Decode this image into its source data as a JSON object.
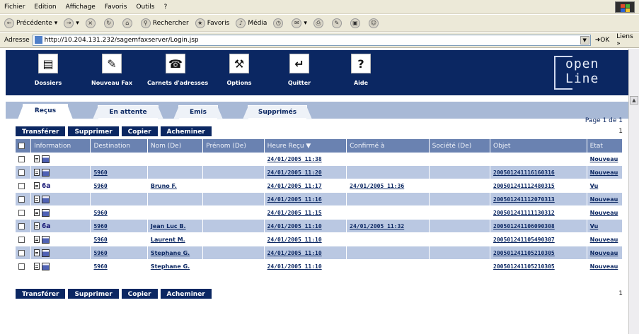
{
  "menubar": {
    "items": [
      "Fichier",
      "Edition",
      "Affichage",
      "Favoris",
      "Outils",
      "?"
    ]
  },
  "toolbar": {
    "back_label": "Précédente",
    "search_label": "Rechercher",
    "favorites_label": "Favoris",
    "media_label": "Média"
  },
  "addressbar": {
    "label": "Adresse",
    "url": "http://10.204.131.232/sagemfaxserver/Login.jsp",
    "go_label": "OK",
    "links_label": "Liens »"
  },
  "banner": {
    "items": [
      {
        "label": "Dossiers",
        "icon": "folders-icon",
        "glyph": "▤"
      },
      {
        "label": "Nouveau Fax",
        "icon": "new-fax-icon",
        "glyph": "✎"
      },
      {
        "label": "Carnets d'adresses",
        "icon": "phone-icon",
        "glyph": "☎"
      },
      {
        "label": "Options",
        "icon": "wrench-icon",
        "glyph": "⚒"
      },
      {
        "label": "Quitter",
        "icon": "exit-icon",
        "glyph": "↵"
      },
      {
        "label": "Aide",
        "icon": "help-icon",
        "glyph": "?"
      }
    ],
    "logo_line1": "open",
    "logo_line2": "Line"
  },
  "tabs": [
    "Reçus",
    "En attente",
    "Emis",
    "Supprimés"
  ],
  "active_tab": "Reçus",
  "pagination": {
    "label": "Page 1 de 1",
    "number": "1"
  },
  "actions": [
    "Transférer",
    "Supprimer",
    "Copier",
    "Acheminer"
  ],
  "columns": [
    "Information",
    "Destination",
    "Nom (De)",
    "Prénom (De)",
    "Heure Reçu ▼",
    "Confirmé à",
    "Société (De)",
    "Objet",
    "Etat"
  ],
  "rows": [
    {
      "info": "fax",
      "destination": "",
      "nom": "",
      "prenom": "",
      "heure": "24/01/2005 11:38",
      "confirme": "",
      "societe": "",
      "objet": "",
      "etat": "Nouveau"
    },
    {
      "info": "fax",
      "destination": "5960",
      "nom": "",
      "prenom": "",
      "heure": "24/01/2005 11:20",
      "confirme": "",
      "societe": "",
      "objet": "200501241116160316",
      "etat": "Nouveau"
    },
    {
      "info": "read",
      "destination": "5960",
      "nom": "Bruno F.",
      "prenom": "",
      "heure": "24/01/2005 11:17",
      "confirme": "24/01/2005 11:36",
      "societe": "",
      "objet": "200501241112480315",
      "etat": "Vu"
    },
    {
      "info": "fax",
      "destination": "",
      "nom": "",
      "prenom": "",
      "heure": "24/01/2005 11:16",
      "confirme": "",
      "societe": "",
      "objet": "200501241112070313",
      "etat": "Nouveau"
    },
    {
      "info": "fax",
      "destination": "5960",
      "nom": "",
      "prenom": "",
      "heure": "24/01/2005 11:15",
      "confirme": "",
      "societe": "",
      "objet": "200501241111130312",
      "etat": "Nouveau"
    },
    {
      "info": "read",
      "destination": "5960",
      "nom": "Jean Luc B.",
      "prenom": "",
      "heure": "24/01/2005 11:10",
      "confirme": "24/01/2005 11:32",
      "societe": "",
      "objet": "200501241106090308",
      "etat": "Vu"
    },
    {
      "info": "fax",
      "destination": "5960",
      "nom": "Laurent M.",
      "prenom": "",
      "heure": "24/01/2005 11:10",
      "confirme": "",
      "societe": "",
      "objet": "200501241105490307",
      "etat": "Nouveau"
    },
    {
      "info": "fax",
      "destination": "5960",
      "nom": "Stephane G.",
      "prenom": "",
      "heure": "24/01/2005 11:10",
      "confirme": "",
      "societe": "",
      "objet": "200501241105210305",
      "etat": "Nouveau"
    },
    {
      "info": "fax",
      "destination": "5960",
      "nom": "Stephane G.",
      "prenom": "",
      "heure": "24/01/2005 11:10",
      "confirme": "",
      "societe": "",
      "objet": "200501241105210305",
      "etat": "Nouveau"
    }
  ],
  "colors": {
    "banner": "#0b2762",
    "header": "#6a82b1",
    "row_alt": "#bac8e2"
  }
}
